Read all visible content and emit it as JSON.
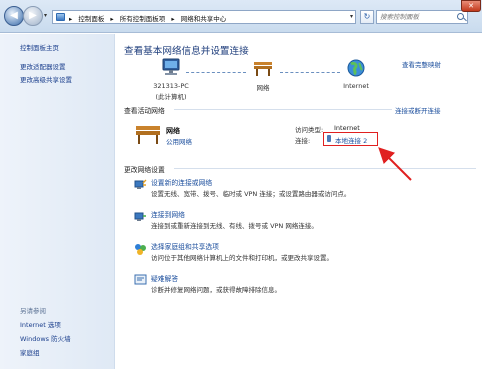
{
  "addressbar": {
    "breadcrumbs": [
      "控制面板",
      "所有控制面板项",
      "网络和共享中心"
    ],
    "search_placeholder": "搜索控制面板"
  },
  "sidebar": {
    "home": "控制面板主页",
    "links": [
      "更改适配器设置",
      "更改高级共享设置"
    ],
    "see_also_heading": "另请参阅",
    "see_also": [
      "Internet 选项",
      "Windows 防火墙",
      "家庭组"
    ]
  },
  "main": {
    "title": "查看基本网络信息并设置连接",
    "full_map_link": "查看完整映射",
    "map": {
      "computer_name": "321313-PC",
      "computer_sub": "(此计算机)",
      "network_label": "网络",
      "internet_label": "Internet"
    },
    "active_heading": "查看活动网络",
    "connect_disconnect_link": "连接或断开连接",
    "network": {
      "name": "网络",
      "type_link": "公用网络",
      "access_type_label": "访问类型:",
      "access_type_value": "Internet",
      "connections_label": "连接:",
      "connection_link": "本地连接 2"
    },
    "change_heading": "更改网络设置",
    "tasks": [
      {
        "title": "设置新的连接或网络",
        "desc": "设置无线、宽带、拨号、临时或 VPN 连接；或设置路由器或访问点。",
        "icon": "new-connection-icon"
      },
      {
        "title": "连接到网络",
        "desc": "连接到或重新连接到无线、有线、拨号或 VPN 网络连接。",
        "icon": "connect-network-icon"
      },
      {
        "title": "选择家庭组和共享选项",
        "desc": "访问位于其他网络计算机上的文件和打印机，或更改共享设置。",
        "icon": "homegroup-icon"
      },
      {
        "title": "疑难解答",
        "desc": "诊断并修复网络问题，或获得故障排除信息。",
        "icon": "troubleshoot-icon"
      }
    ]
  },
  "colors": {
    "link": "#1a4d9c",
    "title": "#1f3e7c",
    "highlight": "#e02020"
  }
}
